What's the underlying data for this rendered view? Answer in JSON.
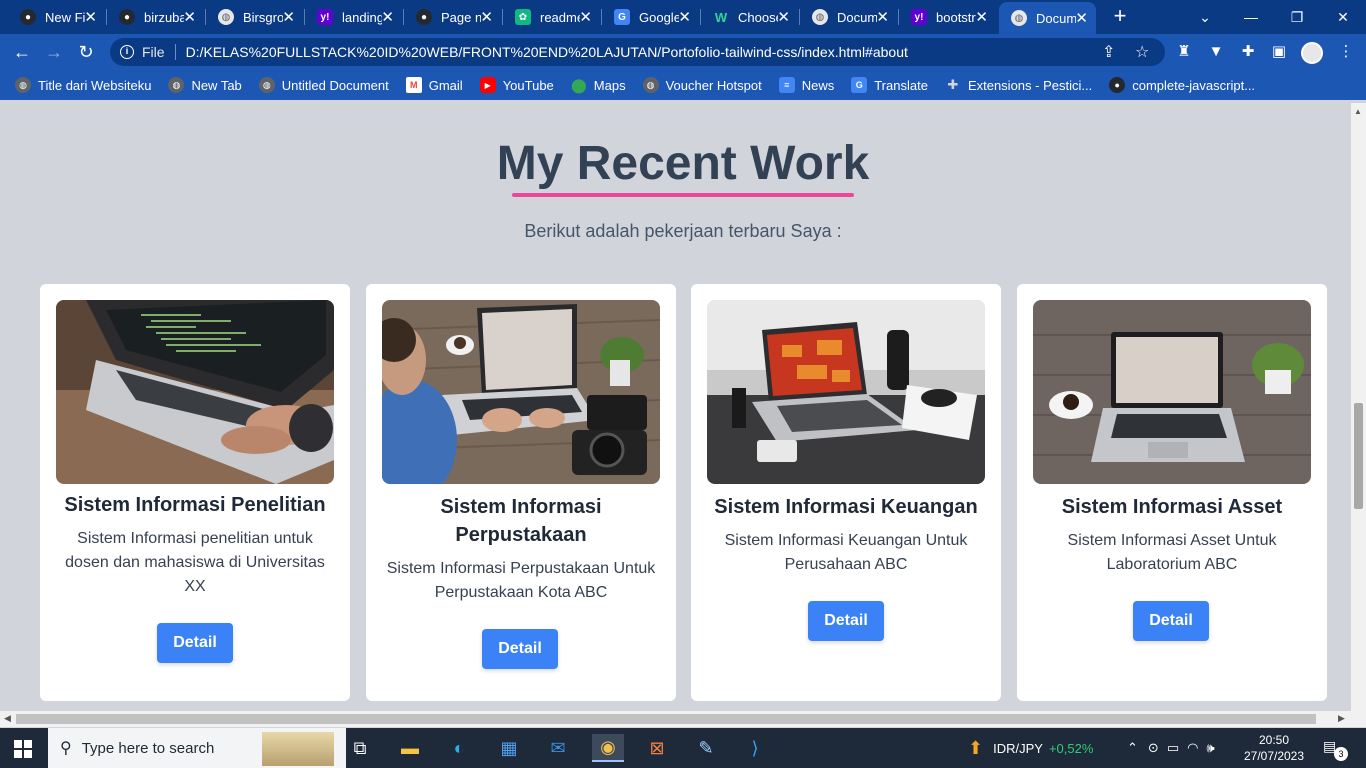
{
  "tabs": [
    {
      "label": "New File",
      "favicon": "github-icon",
      "color": "#24292f"
    },
    {
      "label": "birzubair",
      "favicon": "github-icon",
      "color": "#24292f"
    },
    {
      "label": "Birsgroup",
      "favicon": "globe-icon",
      "color": "#5f6368"
    },
    {
      "label": "landing",
      "favicon": "yahoo-icon",
      "color": "#6001d2"
    },
    {
      "label": "Page not",
      "favicon": "github-icon",
      "color": "#24292f"
    },
    {
      "label": "readme",
      "favicon": "readme-icon",
      "color": "#10b981"
    },
    {
      "label": "Google",
      "favicon": "google-translate-icon",
      "color": "#4285f4"
    },
    {
      "label": "Choose",
      "favicon": "w-icon",
      "color": "#0b8043"
    },
    {
      "label": "Document",
      "favicon": "globe-icon",
      "color": "#5f6368"
    },
    {
      "label": "bootstrap",
      "favicon": "yahoo-icon",
      "color": "#6001d2"
    },
    {
      "label": "Document",
      "favicon": "globe-icon",
      "color": "#5f6368",
      "active": true
    }
  ],
  "address": {
    "scheme_label": "File",
    "url": "D:/KELAS%20FULLSTACK%20ID%20WEB/FRONT%20END%20LAJUTAN/Portofolio-tailwind-css/index.html#about"
  },
  "bookmarks": [
    {
      "label": "Title dari Websiteku",
      "icon": "globe-icon",
      "color": "#5f6368"
    },
    {
      "label": "New Tab",
      "icon": "globe-icon",
      "color": "#5f6368"
    },
    {
      "label": "Untitled Document",
      "icon": "globe-icon",
      "color": "#5f6368"
    },
    {
      "label": "Gmail",
      "icon": "gmail-icon",
      "color": "#ea4335"
    },
    {
      "label": "YouTube",
      "icon": "youtube-icon",
      "color": "#ff0000"
    },
    {
      "label": "Maps",
      "icon": "maps-icon",
      "color": "#34a853"
    },
    {
      "label": "Voucher Hotspot",
      "icon": "globe-icon",
      "color": "#5f6368"
    },
    {
      "label": "News",
      "icon": "google-news-icon",
      "color": "#4285f4"
    },
    {
      "label": "Translate",
      "icon": "google-translate-icon",
      "color": "#4285f4"
    },
    {
      "label": "Extensions - Pestici...",
      "icon": "puzzle-icon",
      "color": "#5f6368"
    },
    {
      "label": "complete-javascript...",
      "icon": "github-icon",
      "color": "#24292f"
    }
  ],
  "page": {
    "heading": "My Recent Work",
    "subtitle": "Berikut adalah pekerjaan terbaru Saya :",
    "accent_color": "#ec4899",
    "button_color": "#3b82f6"
  },
  "cards": [
    {
      "title": "Sistem Informasi Penelitian",
      "description": "Sistem Informasi penelitian untuk dosen dan mahasiswa di Universitas XX",
      "button": "Detail"
    },
    {
      "title": "Sistem Informasi Perpustakaan",
      "description": "Sistem Informasi Perpustakaan Untuk Perpustakaan Kota ABC",
      "button": "Detail"
    },
    {
      "title": "Sistem Informasi Keuangan",
      "description": "Sistem Informasi Keuangan Untuk Perusahaan ABC",
      "button": "Detail"
    },
    {
      "title": "Sistem Informasi Asset",
      "description": "Sistem Informasi Asset Untuk Laboratorium ABC",
      "button": "Detail"
    }
  ],
  "taskbar": {
    "search_placeholder": "Type here to search",
    "currency_pair": "IDR/JPY",
    "currency_change": "+0,52%",
    "time": "20:50",
    "date": "27/07/2023",
    "notification_count": "3"
  }
}
